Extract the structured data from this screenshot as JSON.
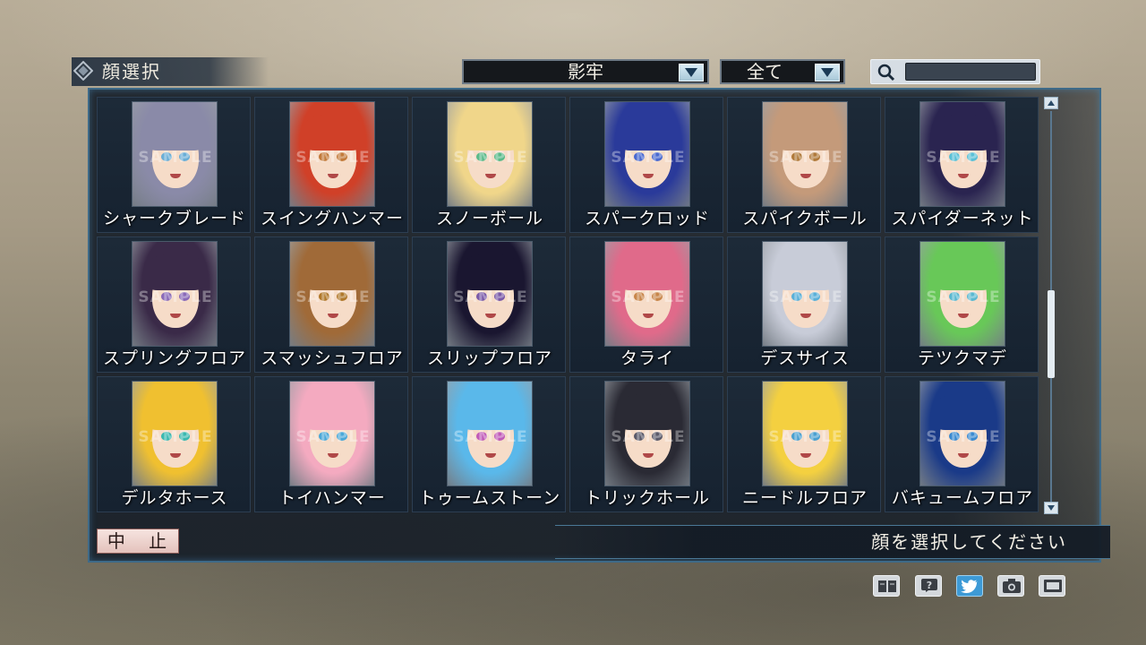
{
  "header": {
    "title": "顔選択"
  },
  "filters": {
    "category_value": "影牢",
    "type_value": "全て"
  },
  "search": {
    "value": ""
  },
  "grid": {
    "items": [
      {
        "label": "シャークブレード",
        "hair": "#8a8aa8",
        "eye": "#6aaed6"
      },
      {
        "label": "スイングハンマー",
        "hair": "#d04028",
        "eye": "#c27a3a"
      },
      {
        "label": "スノーボール",
        "hair": "#f0d68a",
        "eye": "#5aba8a"
      },
      {
        "label": "スパークロッド",
        "hair": "#2a3a9a",
        "eye": "#4a6ad0"
      },
      {
        "label": "スパイクボール",
        "hair": "#c49a7a",
        "eye": "#b07a3a"
      },
      {
        "label": "スパイダーネット",
        "hair": "#2a2450",
        "eye": "#5ac0d6"
      },
      {
        "label": "スプリングフロア",
        "hair": "#3a2a48",
        "eye": "#8a6ab8"
      },
      {
        "label": "スマッシュフロア",
        "hair": "#a06a38",
        "eye": "#b0782a"
      },
      {
        "label": "スリップフロア",
        "hair": "#1a1630",
        "eye": "#7a5aa8"
      },
      {
        "label": "タライ",
        "hair": "#e06a8a",
        "eye": "#c8864a"
      },
      {
        "label": "デスサイス",
        "hair": "#c8ccd8",
        "eye": "#5ab0d8"
      },
      {
        "label": "テツクマデ",
        "hair": "#68c858",
        "eye": "#5ab8d0"
      },
      {
        "label": "デルタホース",
        "hair": "#f0c030",
        "eye": "#3ab8b0"
      },
      {
        "label": "トイハンマー",
        "hair": "#f4aac0",
        "eye": "#4aa8d8"
      },
      {
        "label": "トゥームストーン",
        "hair": "#5ab8ea",
        "eye": "#c05ab8"
      },
      {
        "label": "トリックホール",
        "hair": "#2a2a34",
        "eye": "#5a5a6a"
      },
      {
        "label": "ニードルフロア",
        "hair": "#f4d040",
        "eye": "#4aa0d0"
      },
      {
        "label": "バキュームフロア",
        "hair": "#1a3a88",
        "eye": "#3a8ad0"
      }
    ]
  },
  "footer": {
    "cancel_label": "中 止",
    "message": "顔を選択してください"
  },
  "watermark": "SAMPLE",
  "icons": [
    "manual-icon",
    "help-icon",
    "twitter-icon",
    "camera-icon",
    "screen-icon"
  ]
}
